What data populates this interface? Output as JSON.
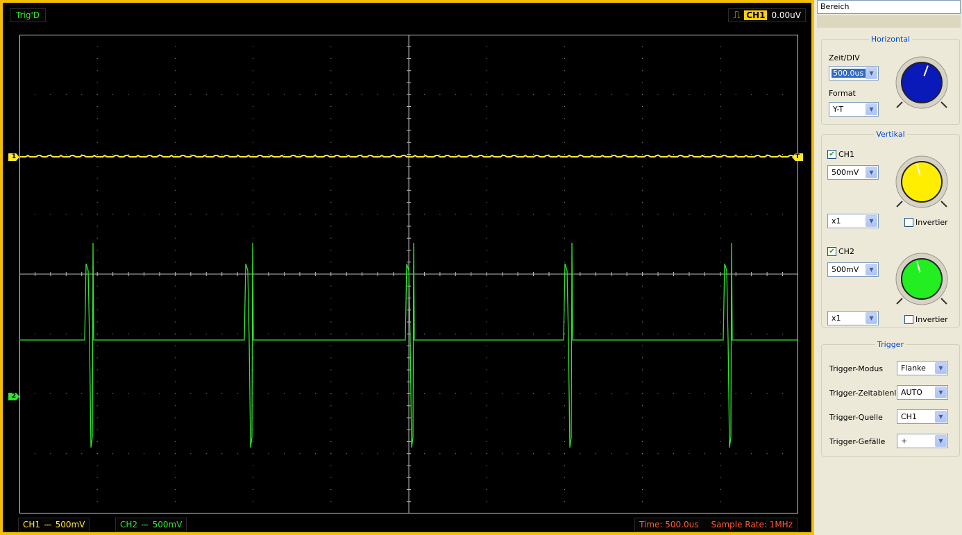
{
  "scope": {
    "trig_status": "Trig'D",
    "trigger_source": "CH1",
    "trigger_level": "0.00uV",
    "ch1_marker": "1",
    "ch2_marker": "2",
    "trigger_marker": "T",
    "status": {
      "ch1_label": "CH1",
      "ch1_coupling": "⎓",
      "ch1_scale": "500mV",
      "ch2_label": "CH2",
      "ch2_coupling": "⎓",
      "ch2_scale": "500mV",
      "time": "Time: 500.0us",
      "sample_rate": "Sample Rate: 1MHz"
    },
    "colors": {
      "ch1": "#ffe82a",
      "ch2": "#2ee62e",
      "grid": "#9a9a9a",
      "frame": "#f2c000"
    }
  },
  "panel": {
    "bereich": "Bereich",
    "horizontal": {
      "title": "Horizontal",
      "zeit_label": "Zeit/DIV",
      "zeit_value": "500.0us",
      "format_label": "Format",
      "format_value": "Y-T",
      "knob_color": "#0a1ab8"
    },
    "vertikal": {
      "title": "Vertikal",
      "ch1_label": "CH1",
      "ch1_volts": "500mV",
      "ch1_probe": "x1",
      "ch1_invert": "Invertier",
      "ch1_knob_color": "#ffee00",
      "ch2_label": "CH2",
      "ch2_volts": "500mV",
      "ch2_probe": "x1",
      "ch2_invert": "Invertier",
      "ch2_knob_color": "#22ee22"
    },
    "trigger": {
      "title": "Trigger",
      "modus_label": "Trigger-Modus",
      "modus_value": "Flanke",
      "zeit_label": "Trigger-Zeitablenl",
      "zeit_value": "AUTO",
      "quelle_label": "Trigger-Quelle",
      "quelle_value": "CH1",
      "gefaelle_label": "Trigger-Gefälle",
      "gefaelle_value": "+"
    }
  }
}
